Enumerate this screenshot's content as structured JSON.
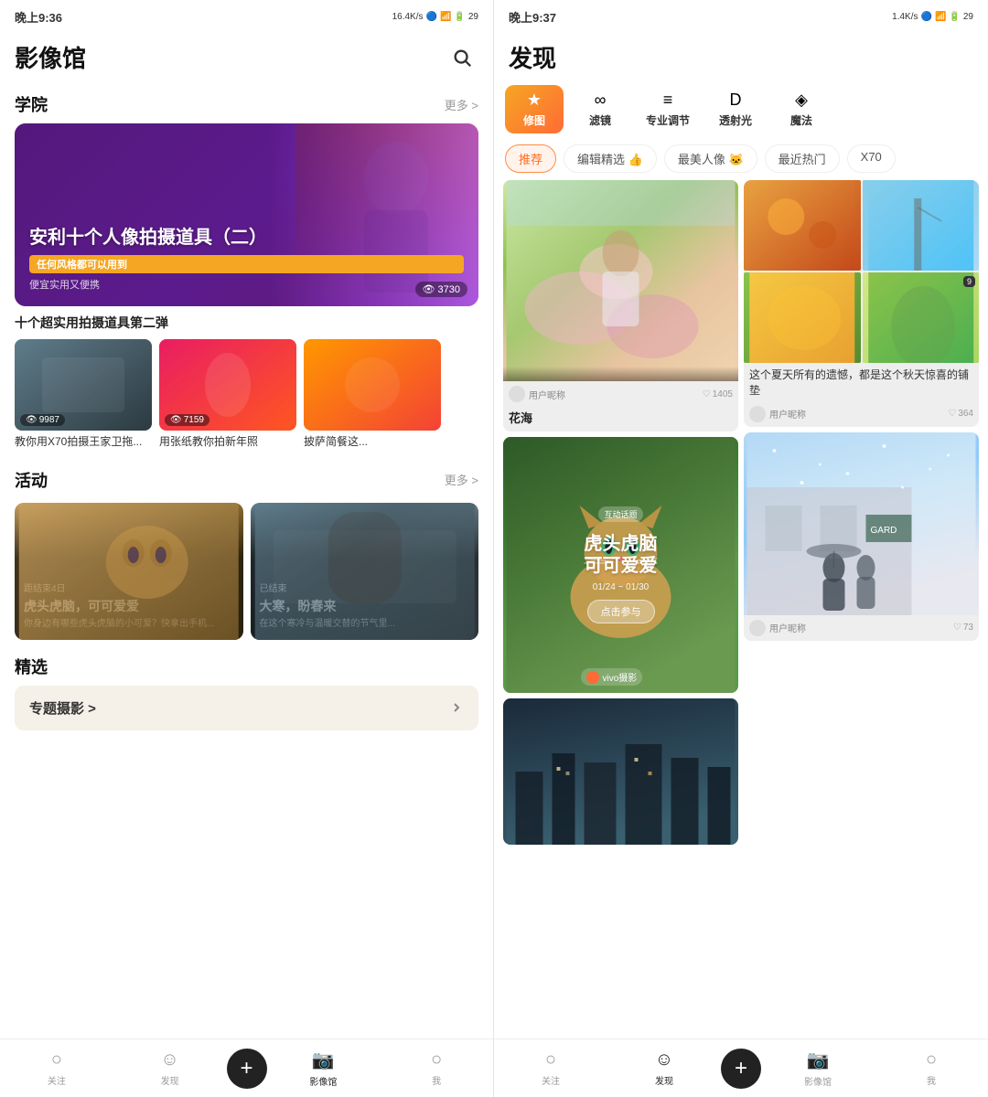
{
  "left": {
    "status": {
      "time": "晚上9:36",
      "network": "16.4K/s",
      "battery": "29"
    },
    "header": {
      "title": "影像馆",
      "search_label": "搜索"
    },
    "academy": {
      "section_title": "学院",
      "more_label": "更多 >",
      "hero": {
        "title": "安利十个人像拍摄道具（二）",
        "badge": "任何风格都可以用到",
        "sub": "便宜实用又便携",
        "count": "3730"
      },
      "subtitle": "十个超实用拍摄道具第二弹",
      "videos": [
        {
          "label": "教你用X70拍摄王家卫拖...",
          "count": "9987",
          "bg": "vt1"
        },
        {
          "label": "用张纸教你拍新年照",
          "count": "7159",
          "bg": "vt2"
        },
        {
          "label": "披萨简餐这...",
          "count": "",
          "bg": "vt3"
        }
      ]
    },
    "activity": {
      "section_title": "活动",
      "more_label": "更多 >",
      "cards": [
        {
          "tag": "距结束4日",
          "title": "虎头虎脑，可可爱爱",
          "desc": "你身边有哪些虎头虎脑的小可爱？快拿出手机...",
          "bg": "ac1"
        },
        {
          "tag": "已结束",
          "title": "大寒，盼春来",
          "desc": "在这个寒冷与温暖交替的节气里...",
          "bg": "ac2"
        }
      ]
    },
    "selected": {
      "section_title": "精选",
      "banner_text": "专题摄影 >"
    },
    "bottom_nav": {
      "items": [
        {
          "label": "关注",
          "icon": "○",
          "active": false
        },
        {
          "label": "发现",
          "icon": "☺",
          "active": false
        },
        {
          "label": "+",
          "icon": "+",
          "active": false,
          "is_add": true
        },
        {
          "label": "影像馆",
          "icon": "📷",
          "active": true
        },
        {
          "label": "我",
          "icon": "○",
          "active": false
        }
      ]
    }
  },
  "right": {
    "status": {
      "time": "晚上9:37",
      "network": "1.4K/s",
      "battery": "29"
    },
    "header": {
      "title": "发现"
    },
    "tools": [
      {
        "label": "修图",
        "icon": "★",
        "active": true
      },
      {
        "label": "滤镜",
        "icon": "∞",
        "active": false
      },
      {
        "label": "专业调节",
        "icon": "≡",
        "active": false
      },
      {
        "label": "透射光",
        "icon": "D",
        "active": false
      },
      {
        "label": "魔法",
        "icon": "◈",
        "active": false
      }
    ],
    "filter_tags": [
      {
        "label": "推荐",
        "active": true
      },
      {
        "label": "编辑精选 👍",
        "active": false
      },
      {
        "label": "最美人像 🐱",
        "active": false
      },
      {
        "label": "最近热门",
        "active": false
      },
      {
        "label": "X70",
        "active": false
      }
    ],
    "masonry": {
      "left_col": [
        {
          "type": "flower",
          "title": "花海",
          "user": "用户昵称",
          "likes": "1405"
        },
        {
          "type": "cat_promo",
          "promo_tag": "互动话题",
          "promo_title": "虎头虎脑\n可可爱爱",
          "date": "01/24 ~ 01/30",
          "btn": "点击参与",
          "publisher": "vivo摄影"
        },
        {
          "type": "dark_city",
          "title": ""
        }
      ],
      "right_col": [
        {
          "type": "autumn_mosaic",
          "title": "这个夏天所有的遗憾，都是这个秋天惊喜的铺垫",
          "likes": "364"
        },
        {
          "type": "snow",
          "title": "",
          "likes": "73"
        }
      ]
    },
    "bottom_nav": {
      "items": [
        {
          "label": "关注",
          "icon": "○",
          "active": false
        },
        {
          "label": "发现",
          "icon": "☺",
          "active": true
        },
        {
          "label": "+",
          "icon": "+",
          "active": false,
          "is_add": true
        },
        {
          "label": "影像馆",
          "icon": "📷",
          "active": false
        },
        {
          "label": "我",
          "icon": "○",
          "active": false
        }
      ]
    }
  }
}
